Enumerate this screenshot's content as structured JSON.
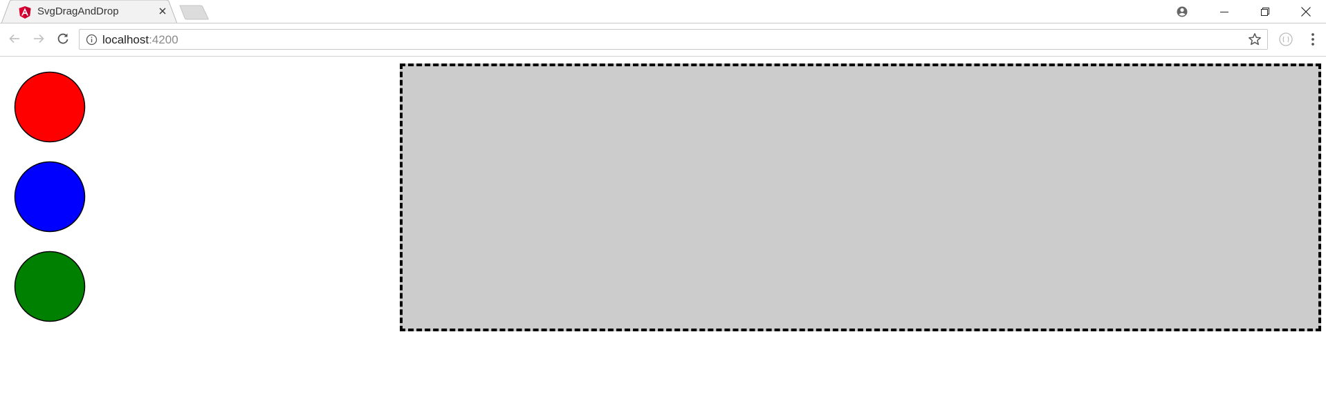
{
  "browser": {
    "tab": {
      "title": "SvgDragAndDrop",
      "favicon": "angular-logo-icon"
    },
    "address_bar": {
      "host": "localhost",
      "port": ":4200"
    }
  },
  "page": {
    "palette": [
      {
        "color": "#ff0000"
      },
      {
        "color": "#0000ff"
      },
      {
        "color": "#008000"
      }
    ],
    "dropzone": {
      "background": "#cccccc",
      "border": "#000000"
    }
  }
}
